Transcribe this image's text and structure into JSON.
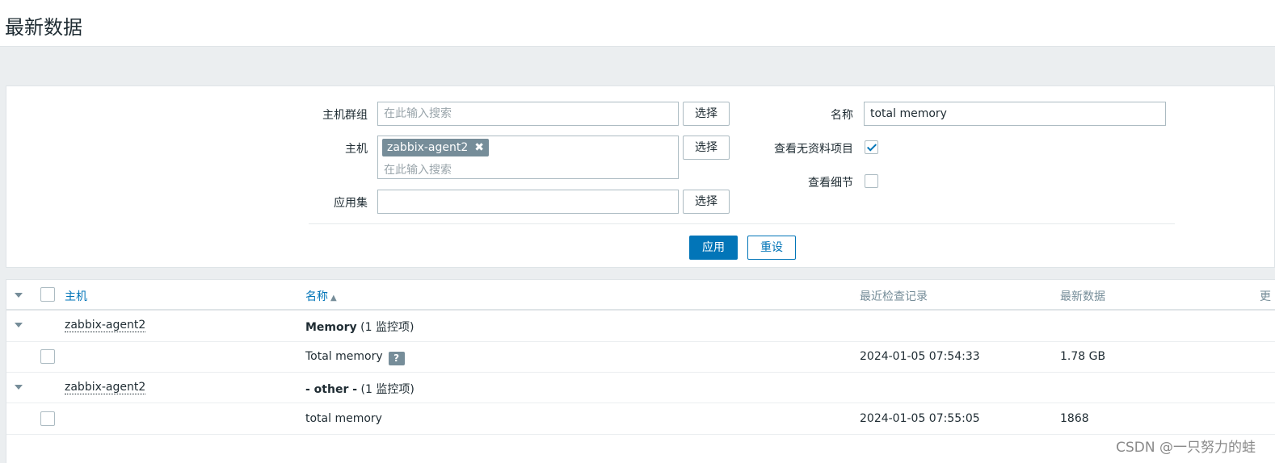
{
  "page": {
    "title": "最新数据"
  },
  "filter": {
    "host_group": {
      "label": "主机群组",
      "placeholder": "在此输入搜索",
      "select": "选择"
    },
    "host": {
      "label": "主机",
      "tag": "zabbix-agent2",
      "placeholder": "在此输入搜索",
      "select": "选择"
    },
    "application": {
      "label": "应用集",
      "value": "",
      "select": "选择"
    },
    "name": {
      "label": "名称",
      "value": "total memory"
    },
    "show_without_data": {
      "label": "查看无资料项目",
      "checked": true
    },
    "show_details": {
      "label": "查看细节",
      "checked": false
    },
    "apply": "应用",
    "reset": "重设"
  },
  "table": {
    "headers": {
      "host": "主机",
      "name": "名称",
      "sort_indicator": "▲",
      "last_check": "最近检查记录",
      "last_value": "最新数据",
      "more": "更"
    },
    "groups": [
      {
        "host": "zabbix-agent2",
        "app_name": "Memory",
        "count": "(1 监控项)",
        "items": [
          {
            "name": "Total memory",
            "has_info": true,
            "info_icon": "?",
            "last_check": "2024-01-05 07:54:33",
            "last_value": "1.78 GB"
          }
        ]
      },
      {
        "host": "zabbix-agent2",
        "app_name": "- other -",
        "count": "(1 监控项)",
        "items": [
          {
            "name": "total memory",
            "has_info": false,
            "last_check": "2024-01-05 07:55:05",
            "last_value": "1868"
          }
        ]
      }
    ]
  },
  "watermark": "CSDN @一只努力的蛙"
}
